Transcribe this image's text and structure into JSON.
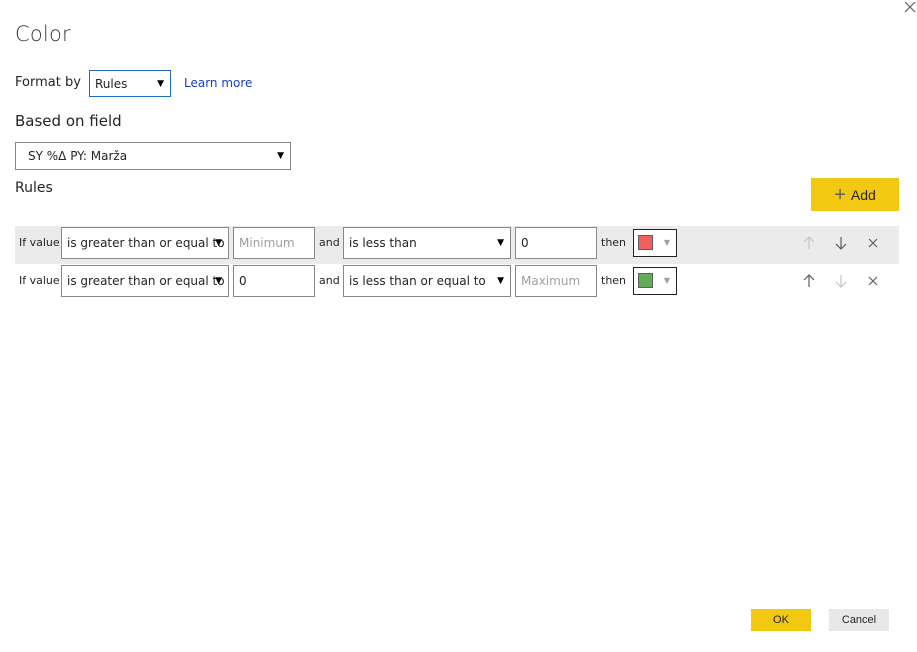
{
  "dialog": {
    "title": "Color",
    "close_icon": "close-icon"
  },
  "format_by": {
    "label": "Format by",
    "selected": "Rules",
    "learn_more": "Learn more"
  },
  "based_on_field": {
    "label": "Based on field",
    "selected": "SY %Δ PY: Marža"
  },
  "rules": {
    "label": "Rules",
    "add_label": "Add",
    "items": [
      {
        "if_label": "If value",
        "condition1": "is greater than or equal to",
        "value1": "",
        "value1_placeholder": "Minimum",
        "and_label": "and",
        "condition2": "is less than",
        "value2": "0",
        "value2_placeholder": "",
        "then_label": "then",
        "color": "#f35f5f",
        "up_enabled": false,
        "down_enabled": true
      },
      {
        "if_label": "If value",
        "condition1": "is greater than or equal to",
        "value1": "0",
        "value1_placeholder": "",
        "and_label": "and",
        "condition2": "is less than or equal to",
        "value2": "",
        "value2_placeholder": "Maximum",
        "then_label": "then",
        "color": "#61ac57",
        "up_enabled": true,
        "down_enabled": false
      }
    ]
  },
  "footer": {
    "ok_label": "OK",
    "cancel_label": "Cancel"
  },
  "colors": {
    "accent": "#f2c811",
    "link": "#1a3dbf",
    "row_shade": "#ebebeb"
  }
}
